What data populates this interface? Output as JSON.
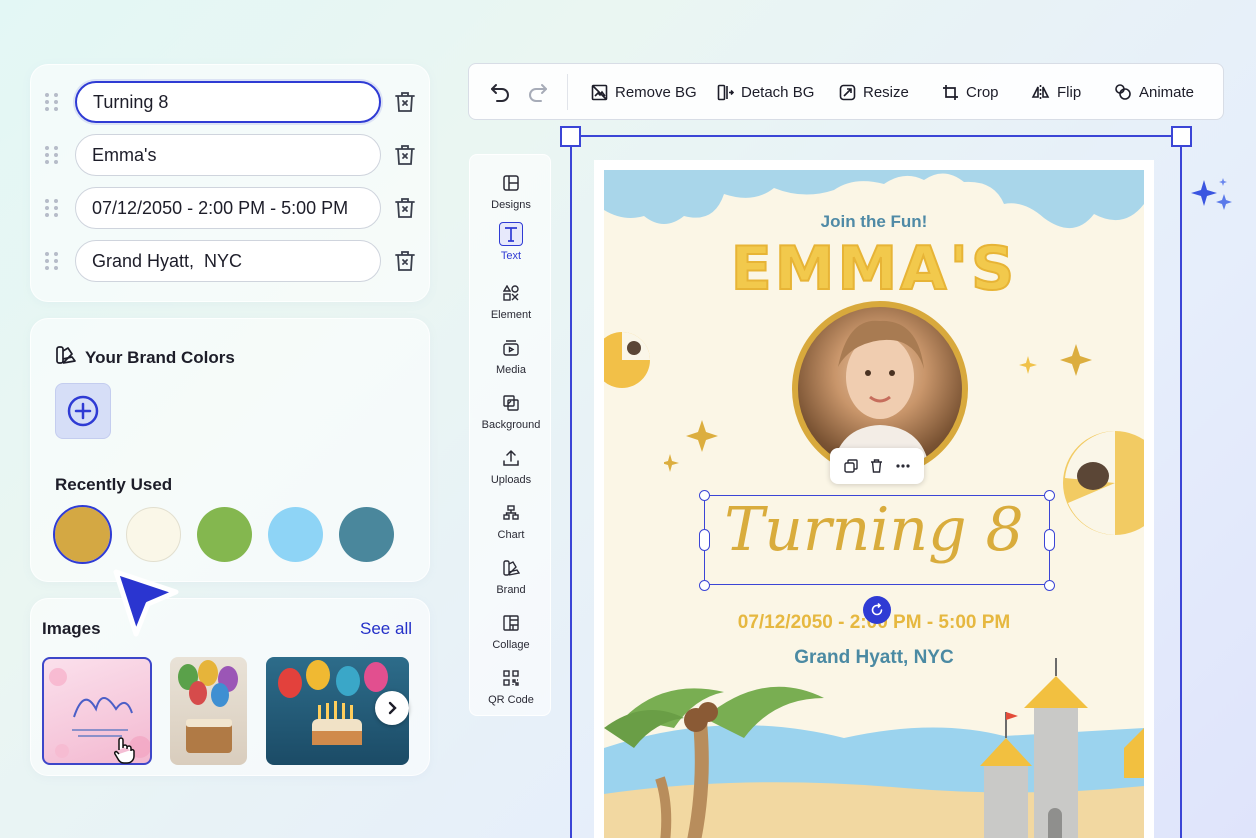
{
  "text_fields": [
    {
      "value": "Turning 8",
      "active": true
    },
    {
      "value": "Emma's",
      "active": false
    },
    {
      "value": "07/12/2050 - 2:00 PM - 5:00 PM",
      "active": false
    },
    {
      "value": "Grand Hyatt,  NYC",
      "active": false
    }
  ],
  "brand": {
    "title": "Your Brand Colors",
    "recent_title": "Recently Used",
    "recent_colors": [
      "#d4a843",
      "#faf7e8",
      "#84b74f",
      "#8ed4f6",
      "#4a879c"
    ]
  },
  "images": {
    "title": "Images",
    "see_all": "See all"
  },
  "toolbar": {
    "remove_bg": "Remove BG",
    "detach_bg": "Detach BG",
    "resize": "Resize",
    "crop": "Crop",
    "flip": "Flip",
    "animate": "Animate"
  },
  "sidenav": [
    {
      "label": "Designs",
      "icon": "layout-icon"
    },
    {
      "label": "Text",
      "icon": "text-icon",
      "active": true
    },
    {
      "label": "Element",
      "icon": "shapes-icon"
    },
    {
      "label": "Media",
      "icon": "media-icon"
    },
    {
      "label": "Background",
      "icon": "background-icon"
    },
    {
      "label": "Uploads",
      "icon": "upload-icon"
    },
    {
      "label": "Chart",
      "icon": "chart-icon"
    },
    {
      "label": "Brand",
      "icon": "brand-icon"
    },
    {
      "label": "Collage",
      "icon": "collage-icon"
    },
    {
      "label": "QR Code",
      "icon": "qr-code-icon"
    }
  ],
  "card": {
    "join": "Join the Fun!",
    "name": "EMMA'S",
    "turning": "Turning 8",
    "date": "07/12/2050 - 2:00 PM - 5:00 PM",
    "venue": "Grand Hyatt, NYC"
  },
  "colors": {
    "accent": "#2f3bd4",
    "card_gold": "#f2c94c",
    "card_blue": "#4f8aa6"
  }
}
